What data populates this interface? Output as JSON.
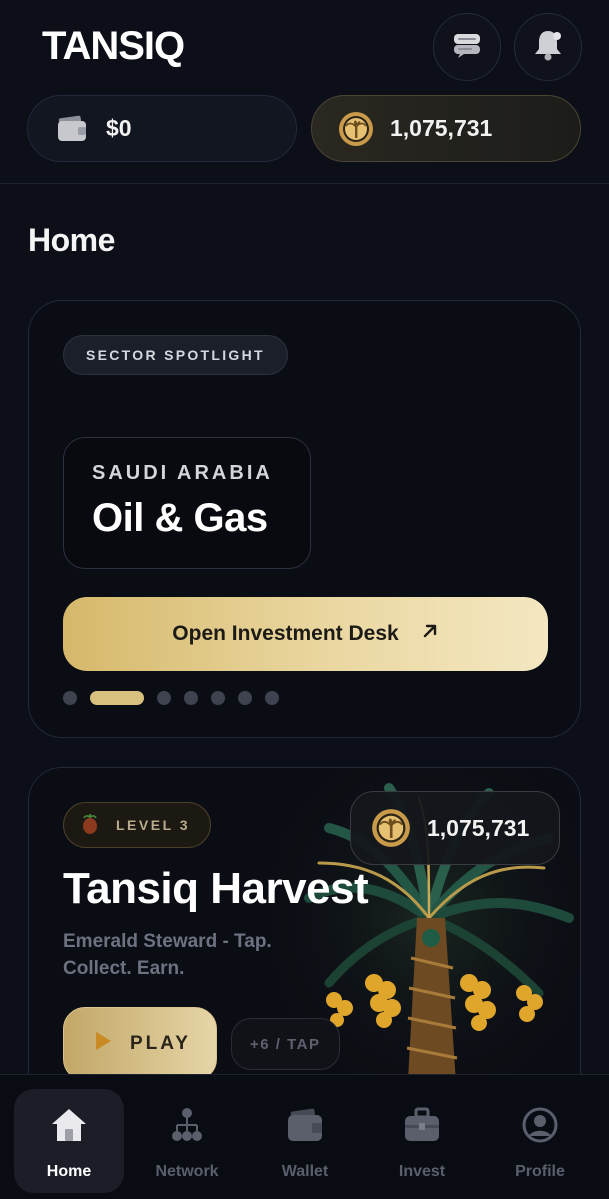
{
  "header": {
    "logo": "TANSIQ",
    "icons": [
      "chat-icon",
      "bell-icon"
    ]
  },
  "balances": {
    "cash": {
      "icon": "wallet-icon",
      "value": "$0"
    },
    "coins": {
      "icon": "palm-coin-icon",
      "value": "1,075,731"
    }
  },
  "page": {
    "title": "Home"
  },
  "spotlight": {
    "tag": "SECTOR SPOTLIGHT",
    "country": "SAUDI ARABIA",
    "sector": "Oil & Gas",
    "button_label": "Open Investment Desk",
    "button_icon": "arrow-up-right-icon",
    "carousel": {
      "count": 7,
      "active_index": 1
    }
  },
  "harvest": {
    "level_label": "LEVEL 3",
    "level_icon": "date-fruit-icon",
    "coins": "1,075,731",
    "title": "Tansiq Harvest",
    "subtitle": "Emerald Steward - Tap. Collect. Earn.",
    "play_label": "PLAY",
    "tap_label": "+6 / TAP",
    "image": "date-palm-tree"
  },
  "nav": {
    "items": [
      {
        "label": "Home",
        "icon": "home-icon",
        "active": true
      },
      {
        "label": "Network",
        "icon": "network-icon",
        "active": false
      },
      {
        "label": "Wallet",
        "icon": "wallet-icon",
        "active": false
      },
      {
        "label": "Invest",
        "icon": "briefcase-icon",
        "active": false
      },
      {
        "label": "Profile",
        "icon": "profile-icon",
        "active": false
      }
    ]
  },
  "colors": {
    "background": "#0c0f18",
    "accent_gold": "#d8c07e",
    "muted_text": "#5b5f6c"
  }
}
